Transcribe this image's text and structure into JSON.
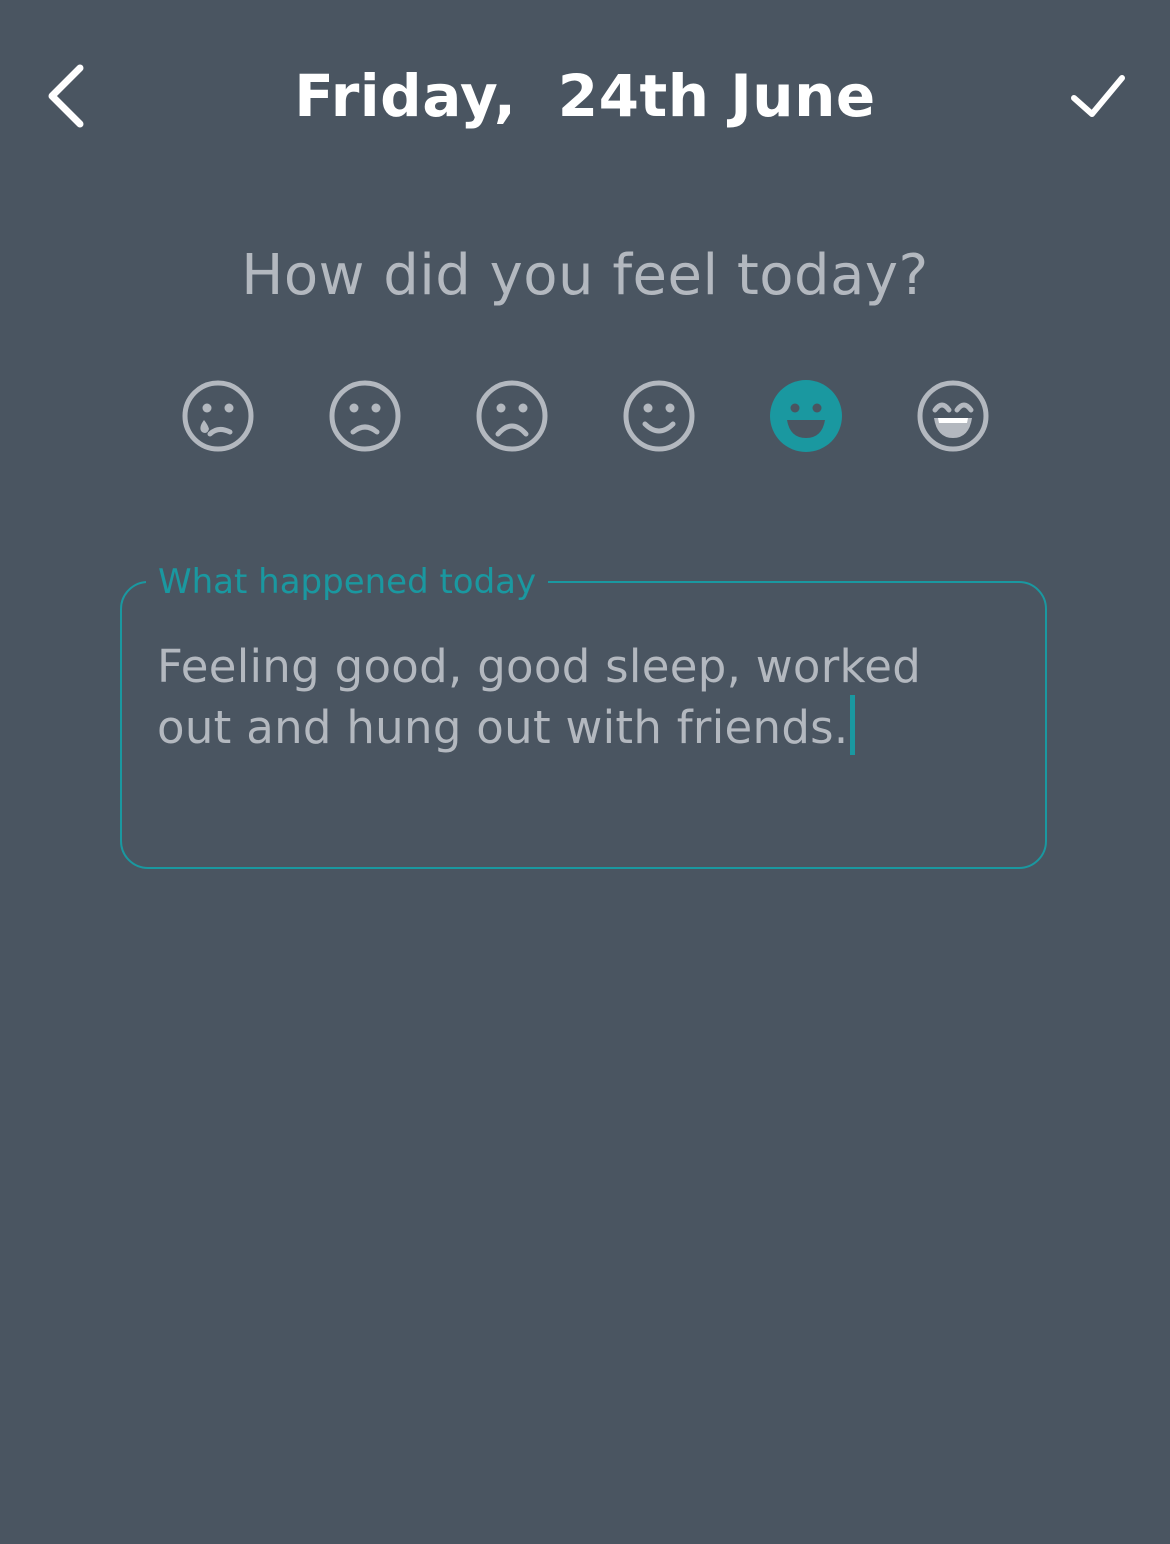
{
  "header": {
    "title": "Friday,  24th June",
    "back_icon": "chevron-left-icon",
    "save_icon": "check-icon"
  },
  "prompt": "How did you feel today?",
  "moods": {
    "selected_index": 4,
    "items": [
      {
        "icon": "crying-face-icon"
      },
      {
        "icon": "sad-face-icon"
      },
      {
        "icon": "frowning-face-icon"
      },
      {
        "icon": "smiling-face-icon"
      },
      {
        "icon": "grinning-face-icon"
      },
      {
        "icon": "laughing-face-icon"
      }
    ]
  },
  "entry": {
    "label": "What happened today",
    "value_line1": "Feeling good, good sleep, worked",
    "value_line2": "out and hung out with friends."
  },
  "colors": {
    "background": "#4a5561",
    "accent": "#1a98a0",
    "muted_text": "#b3b8bf",
    "title_text": "#ffffff"
  }
}
